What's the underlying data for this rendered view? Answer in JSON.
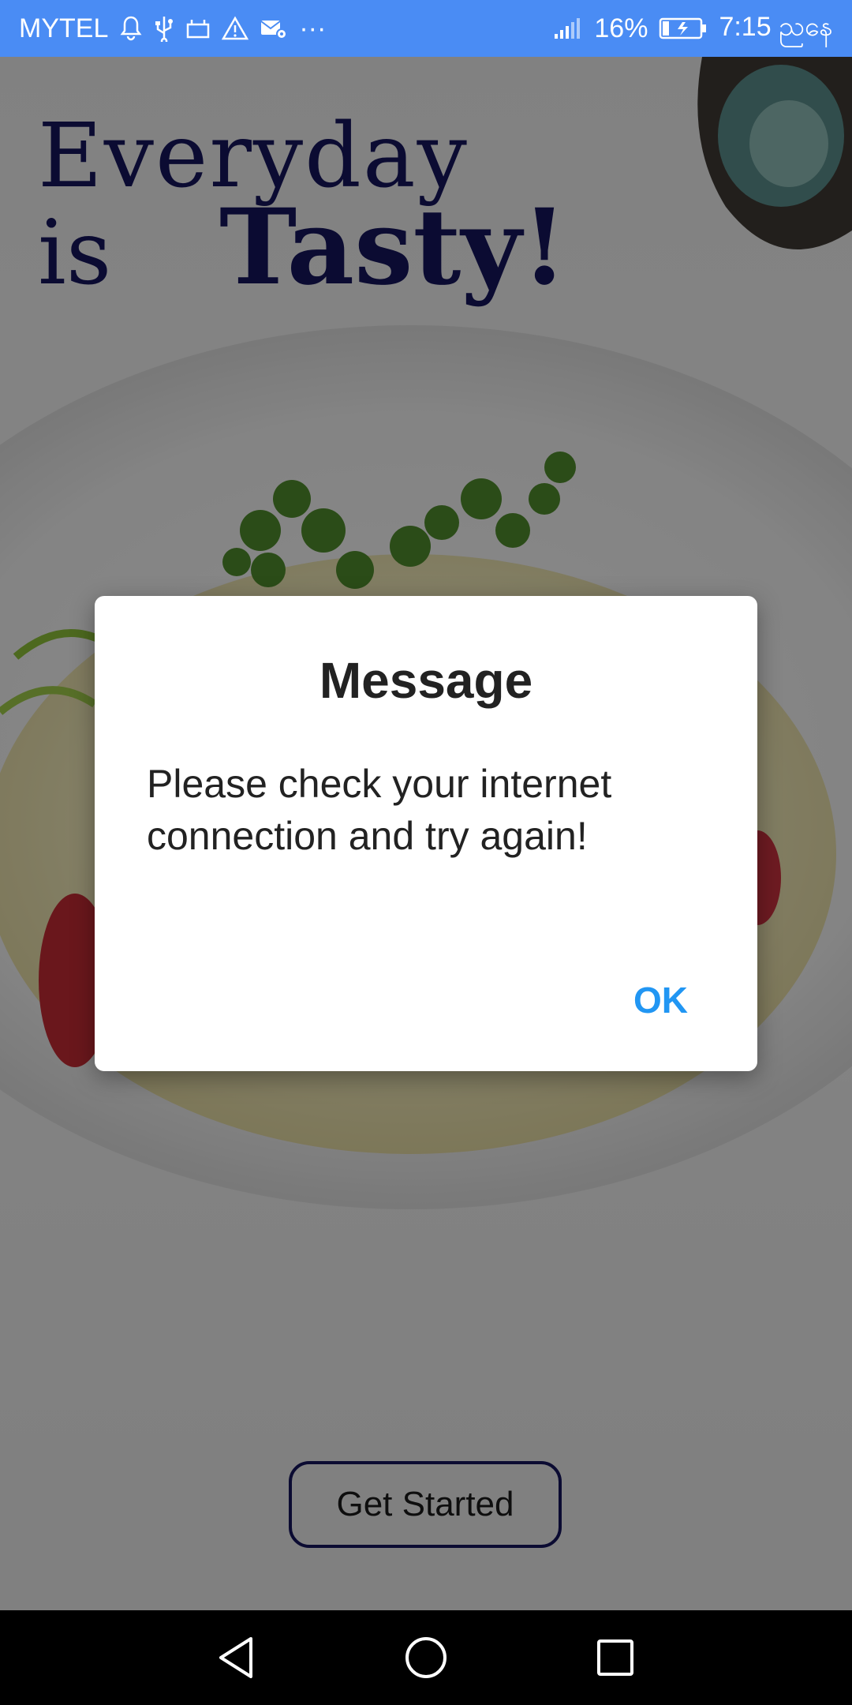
{
  "status_bar": {
    "carrier": "MYTEL",
    "more_indicator": "···",
    "battery_percent": "16%",
    "time": "7:15 ညနေ",
    "icons": [
      "bell-icon",
      "usb-icon",
      "tray-icon",
      "warning-icon",
      "mail-gear-icon",
      "signal-icon",
      "battery-charging-icon"
    ]
  },
  "headline": {
    "line1": "Everyday",
    "line2_prefix": "is",
    "line2_emphasis": "Tasty!"
  },
  "main": {
    "get_started_label": "Get Started"
  },
  "dialog": {
    "title": "Message",
    "message": "Please check your internet connection and try again!",
    "ok_label": "OK"
  },
  "navigation": {
    "icons": [
      "back-icon",
      "home-icon",
      "recents-icon"
    ]
  },
  "colors": {
    "status_bar": "#4a8cf4",
    "headline": "#15155c",
    "dialog_button": "#2196f3",
    "nav_bar": "#000000"
  }
}
